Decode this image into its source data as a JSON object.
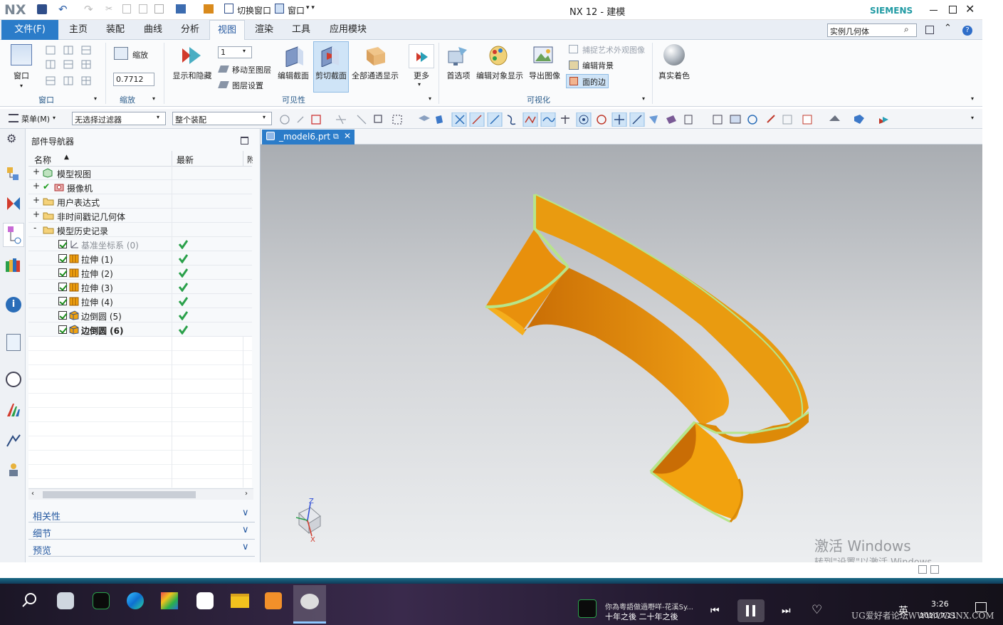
{
  "app": {
    "logo": "NX",
    "title": "NX 12 - 建模",
    "brand": "SIEMENS"
  },
  "quick": {
    "switch_window": "切换窗口",
    "window": "窗口"
  },
  "menu_tabs": [
    "文件(F)",
    "主页",
    "装配",
    "曲线",
    "分析",
    "视图",
    "渲染",
    "工具",
    "应用模块"
  ],
  "search": {
    "value": "实例几何体"
  },
  "ribbon": {
    "window_label": "窗口",
    "zoom_label": "缩放",
    "zoom_value": "0.7712",
    "layer_value": "1",
    "show_hide": "显示和隐藏",
    "move_layer": "移动至图层",
    "layer_settings": "图层设置",
    "edit_section": "编辑截面",
    "clip_section": "剪切截面",
    "all_through": "全部通透显示",
    "more": "更多",
    "prefs": "首选项",
    "edit_obj_display": "编辑对象显示",
    "export_image": "导出图像",
    "capture_art": "捕捉艺术外观图像",
    "edit_bg": "编辑背景",
    "face_edge": "面的边",
    "true_shading": "真实着色",
    "groups": {
      "window": "窗口",
      "zoom": "缩放",
      "visibility": "可见性",
      "visualize": "可视化"
    }
  },
  "toolbar2": {
    "menu": "菜单(M)",
    "filter": "无选择过滤器",
    "scope": "整个装配"
  },
  "navigator": {
    "title": "部件导航器",
    "col_name": "名称",
    "col_latest": "最新",
    "col_extra": "附",
    "items": [
      {
        "label": "模型视图",
        "level": 0,
        "expand": "+"
      },
      {
        "label": "摄像机",
        "level": 0,
        "expand": "+"
      },
      {
        "label": "用户表达式",
        "level": 0,
        "expand": "+"
      },
      {
        "label": "非时间戳记几何体",
        "level": 0,
        "expand": "+"
      },
      {
        "label": "模型历史记录",
        "level": 0,
        "expand": "-"
      },
      {
        "label": "基准坐标系 (0)",
        "level": 1
      },
      {
        "label": "拉伸 (1)",
        "level": 1
      },
      {
        "label": "拉伸 (2)",
        "level": 1
      },
      {
        "label": "拉伸 (3)",
        "level": 1
      },
      {
        "label": "拉伸 (4)",
        "level": 1
      },
      {
        "label": "边倒圆 (5)",
        "level": 1
      },
      {
        "label": "边倒圆 (6)",
        "level": 1
      }
    ],
    "sections": [
      "相关性",
      "细节",
      "预览"
    ]
  },
  "viewport": {
    "tab": "_model6.prt",
    "watermark_title": "激活 Windows",
    "watermark_sub": "转到\"设置\"以激活 Windows。"
  },
  "taskbar": {
    "song_title": "你為粵語做過嘢咩-花溪Sy...",
    "song_sub": "十年之後 二十年之後",
    "time": "3:26",
    "date": "2020/7/11",
    "lang": "英",
    "forum": "UG爱好者论坛WWW.UGSNX.COM"
  },
  "colors": {
    "accent": "#2b7cc9",
    "part": "#f2a20e",
    "edge": "#b7e58a"
  }
}
